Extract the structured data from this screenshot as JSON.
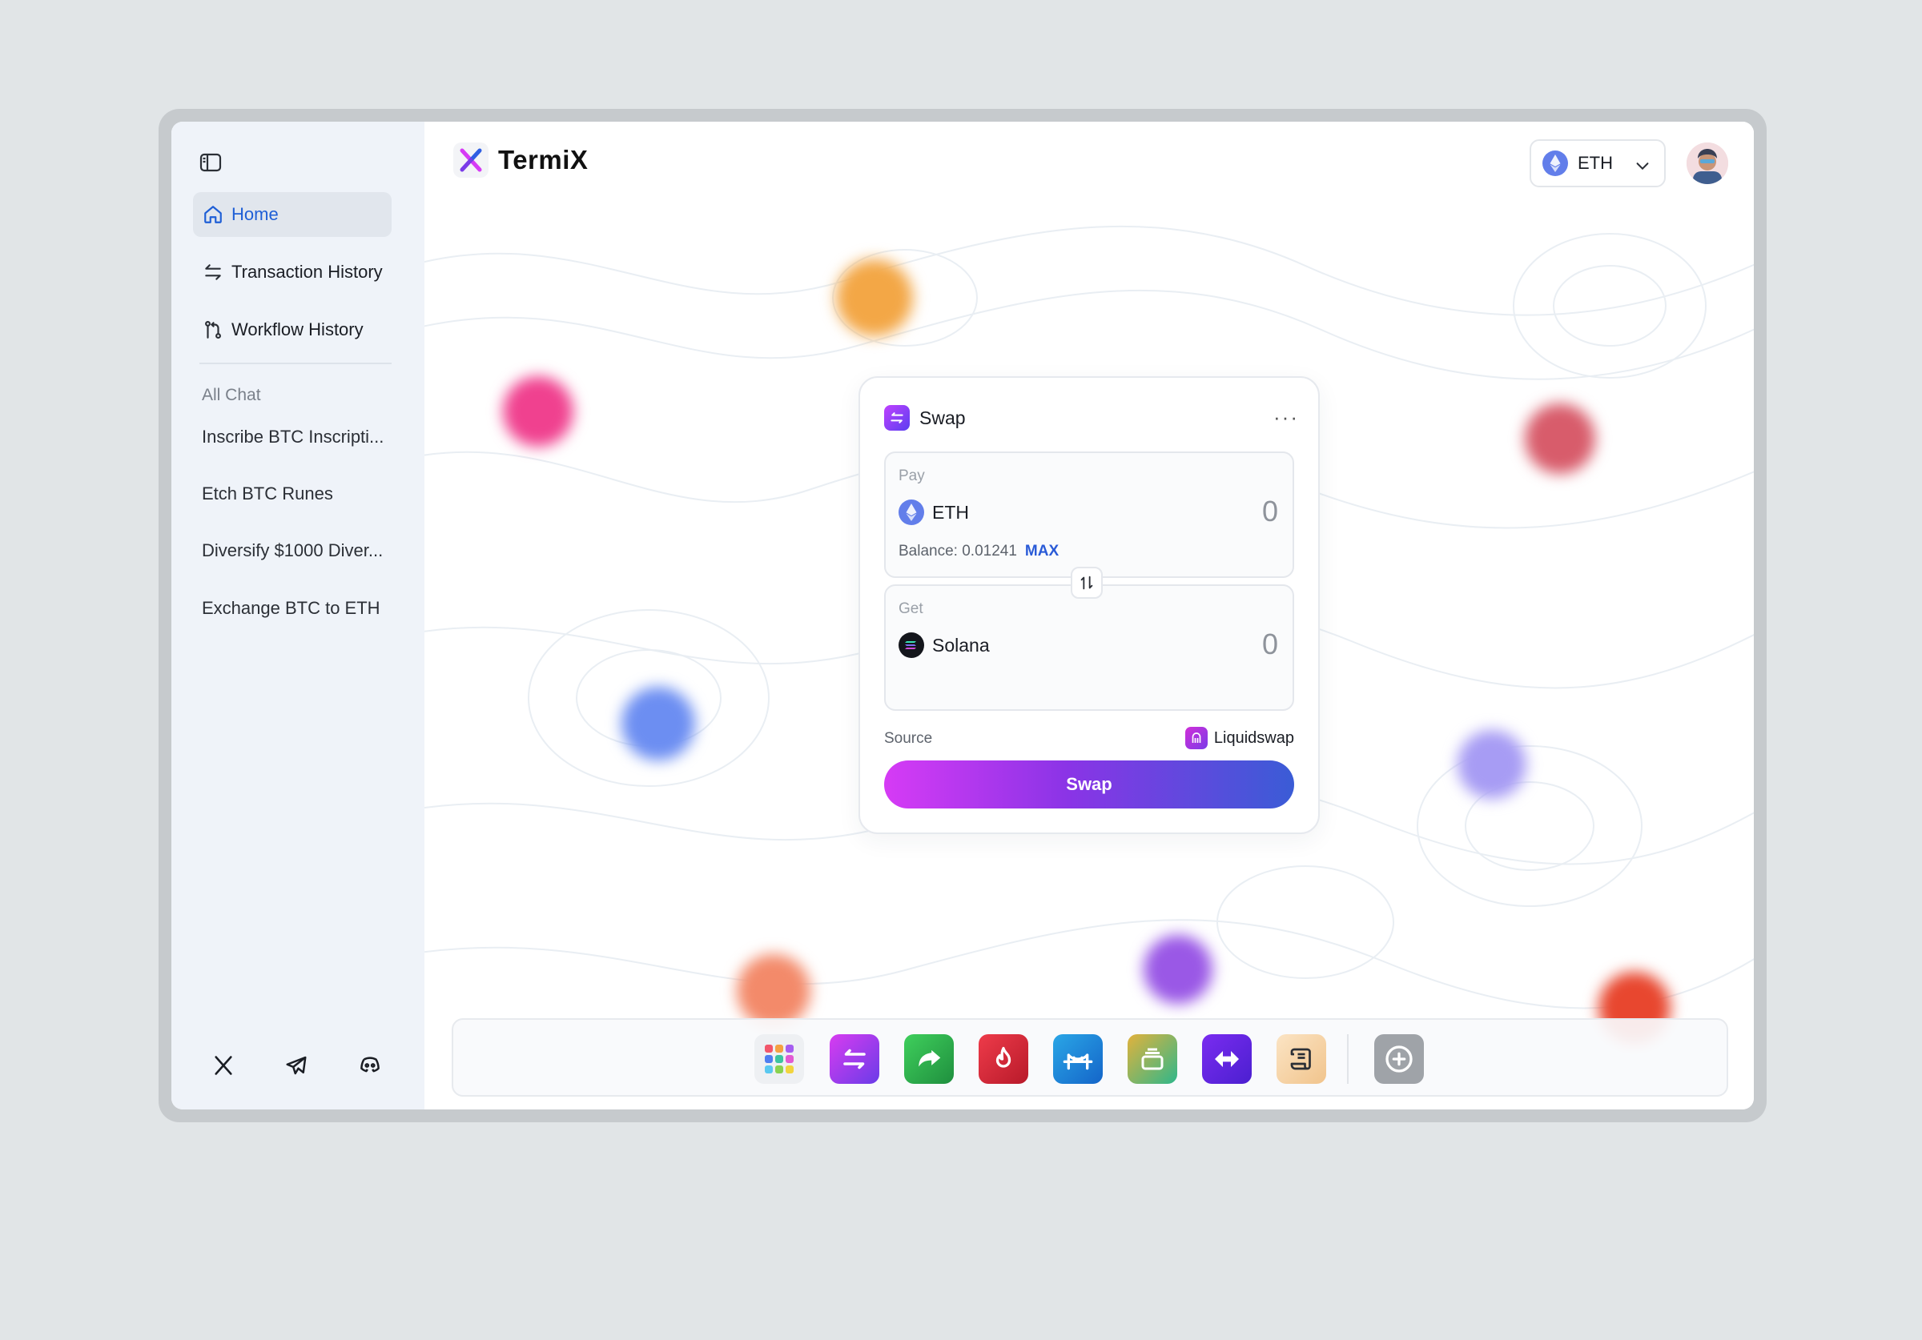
{
  "sidebar": {
    "nav": [
      {
        "label": "Home",
        "icon": "home-icon",
        "active": true
      },
      {
        "label": "Transaction History",
        "icon": "arrows-swap-icon"
      },
      {
        "label": "Workflow History",
        "icon": "git-branch-icon"
      }
    ],
    "chat_heading": "All Chat",
    "chats": [
      "Inscribe BTC Inscripti...",
      "Etch BTC Runes",
      "Diversify $1000 Diver...",
      "Exchange BTC to ETH"
    ],
    "social": [
      "x-icon",
      "telegram-icon",
      "discord-icon"
    ]
  },
  "header": {
    "brand": "TermiX",
    "network": "ETH"
  },
  "swap": {
    "title": "Swap",
    "more": "···",
    "pay": {
      "label": "Pay",
      "token": "ETH",
      "amount": "0",
      "balance_label": "Balance: 0.01241",
      "max": "MAX"
    },
    "get": {
      "label": "Get",
      "token": "Solana",
      "amount": "0"
    },
    "source_label": "Source",
    "source_value": "Liquidswap",
    "button": "Swap"
  },
  "dock": {
    "apps": [
      "apps-grid-icon",
      "swap-app-icon",
      "send-app-icon",
      "burn-app-icon",
      "bridge-app-icon",
      "stack-app-icon",
      "exchange-app-icon",
      "scroll-app-icon"
    ],
    "add": "add-app-icon"
  },
  "colors": {
    "accent": "#1f5fd6",
    "swap_gradient_start": "#d63bf5",
    "swap_gradient_end": "#3a5cd6"
  }
}
